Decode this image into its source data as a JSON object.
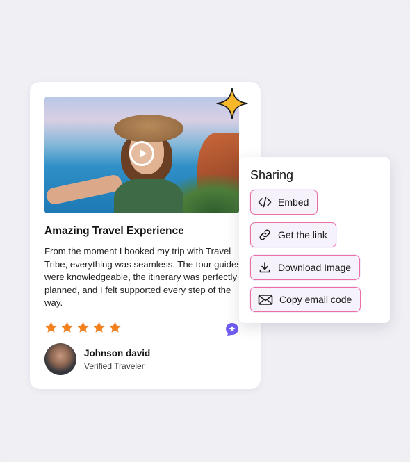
{
  "review": {
    "title": "Amazing Travel Experience",
    "body": "From the moment I booked my trip with Travel Tribe, everything was seamless. The tour guides were knowledgeable, the itinerary was perfectly planned, and I felt supported every step of the way.",
    "rating": 5,
    "rating_max": 5,
    "author_name": "Johnson david",
    "author_role": "Verified Traveler",
    "media_icon": "play-icon",
    "badge_icon": "star-badge-icon"
  },
  "sharing": {
    "title": "Sharing",
    "options": [
      {
        "label": "Embed",
        "icon": "code-icon"
      },
      {
        "label": "Get the link",
        "icon": "link-icon"
      },
      {
        "label": "Download Image",
        "icon": "download-icon"
      },
      {
        "label": "Copy email code",
        "icon": "mail-icon"
      }
    ]
  },
  "colors": {
    "star": "#f5811e",
    "badge": "#6f5cf0",
    "button_border": "#ea6fa3",
    "sparkle": "#f6b72a"
  }
}
